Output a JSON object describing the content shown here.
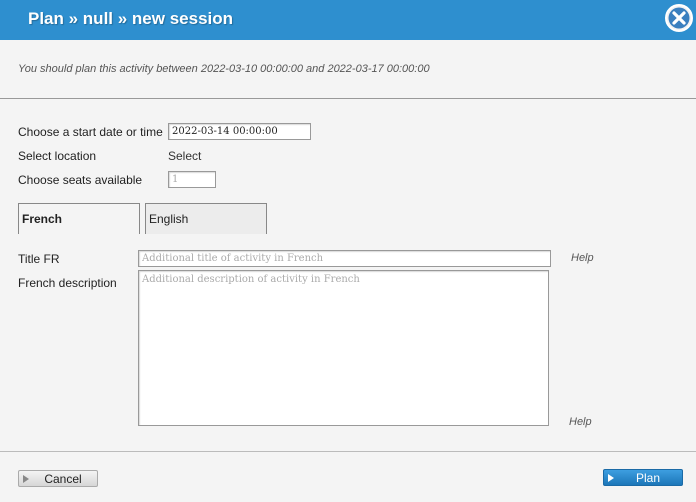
{
  "header": {
    "title": "Plan » null » new session",
    "close_icon": "close-circle-x-icon"
  },
  "notice": "You should plan this activity between 2022-03-10 00:00:00 and 2022-03-17 00:00:00",
  "form": {
    "start_label": "Choose a start date or time",
    "start_value": "2022-03-14 00:00:00",
    "location_label": "Select location",
    "location_link": "Select",
    "seats_label": "Choose seats available",
    "seats_placeholder": "1"
  },
  "tabs": [
    {
      "label": "French",
      "active": true
    },
    {
      "label": "English",
      "active": false
    }
  ],
  "french": {
    "title_label": "Title FR",
    "title_placeholder": "Additional title of activity in French",
    "desc_label": "French description",
    "desc_placeholder": "Additional description of activity in French",
    "help_label": "Help"
  },
  "footer": {
    "cancel_label": "Cancel",
    "plan_label": "Plan"
  },
  "colors": {
    "header_bg": "#2e8fcf",
    "plan_button": "#1c76b8"
  }
}
